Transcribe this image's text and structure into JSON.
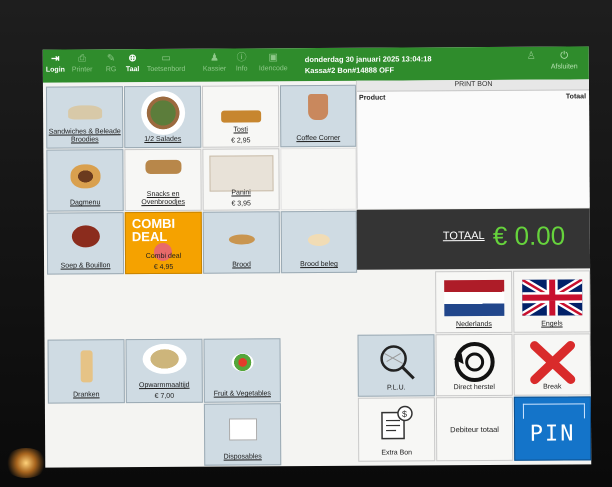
{
  "toolbar": {
    "login": "Login",
    "printer": "Printer",
    "rg": "RG",
    "taal": "Taal",
    "toetsenbord": "Toetsenbord",
    "kassier": "Kassier",
    "info": "Info",
    "idencode": "Idencode",
    "datetime": "donderdag 30 januari 2025 13:04:18",
    "status": "Kassa#2 Bon#14888 OFF",
    "afsluiten": "Afsluiten"
  },
  "receipt": {
    "header": "PRINT BON",
    "col_product": "Product",
    "col_total": "Totaal"
  },
  "totals": {
    "label": "TOTAAL",
    "value": "€ 0.00"
  },
  "categories": {
    "sandwiches": "Sandwiches & Beleade Broodies",
    "salades": "1/2 Salades",
    "tosti": "Tosti",
    "tosti_price": "€ 2,95",
    "coffee": "Coffee Corner",
    "dagmenu": "Dagmenu",
    "snacks": "Snacks en Ovenbroodjes",
    "panini": "Panini",
    "panini_price": "€ 3,95",
    "soep": "Soep & Bouillon",
    "combi_banner": "COMBI DEAL",
    "combi": "Combi deal",
    "combi_price": "€ 4,95",
    "brood": "Brood",
    "broodbeleg": "Brood beleg",
    "dranken": "Dranken",
    "opwarm": "Opwarmmaaltijd",
    "opwarm_price": "€ 7,00",
    "fruit": "Fruit & Vegetables",
    "disposables": "Disposables"
  },
  "actions": {
    "nederlands": "Nederlands",
    "engels": "Engels",
    "plu": "P.L.U.",
    "direct_herstel": "Direct herstel",
    "break": "Break",
    "extra_bon": "Extra Bon",
    "debiteur": "Debiteur totaal",
    "pin_badge": "PIN"
  },
  "colors": {
    "toolbar": "#2f8c2c",
    "total_bg": "#343434",
    "total_value": "#66d33c",
    "combi_tile": "#f5a200"
  }
}
